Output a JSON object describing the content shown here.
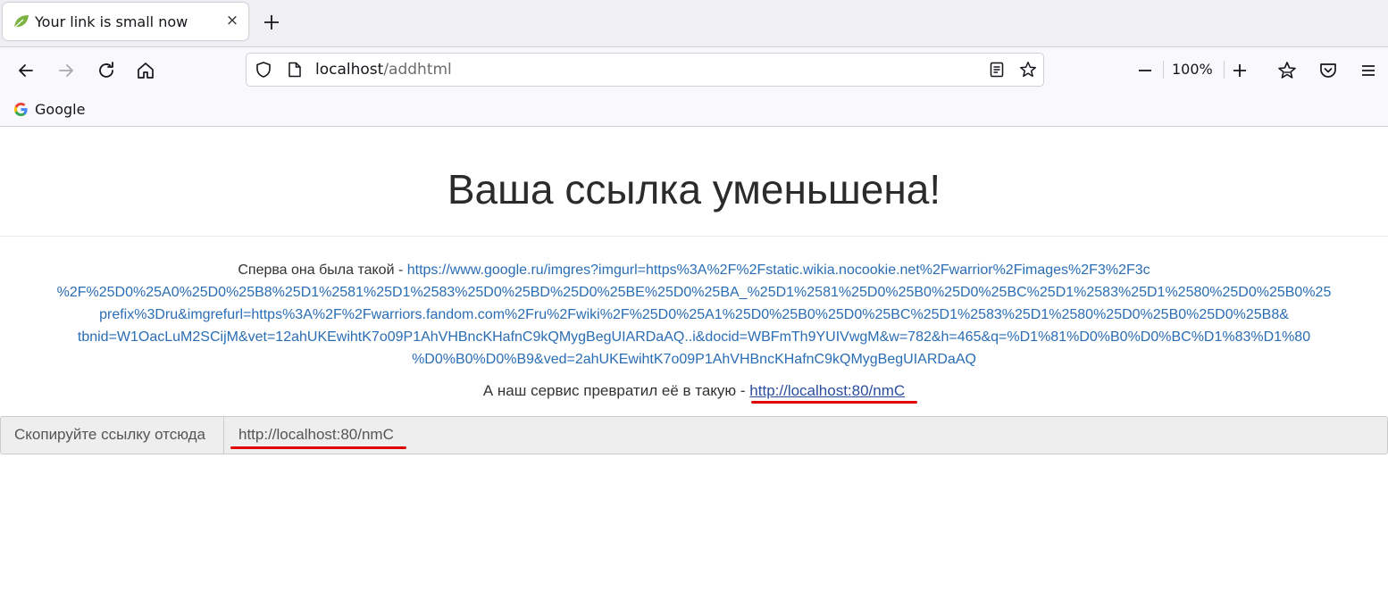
{
  "tab": {
    "title": "Your link is small now",
    "close": "×",
    "new_tab": "+"
  },
  "address_bar": {
    "host": "localhost",
    "path": "/addhtml"
  },
  "toolbar": {
    "zoom": "100%"
  },
  "bookmarks": [
    {
      "label": "Google"
    }
  ],
  "page": {
    "heading": "Ваша ссылка уменьшена!",
    "original_prefix": "Сперва она была такой - ",
    "original_url_lines": [
      "https://www.google.ru/imgres?imgurl=https%3A%2F%2Fstatic.wikia.nocookie.net%2Fwarrior%2Fimages%2F3%2F3c",
      "%2F%25D0%25A0%25D0%25B8%25D1%2581%25D1%2583%25D0%25BD%25D0%25BE%25D0%25BA_%25D1%2581%25D0%25B0%25D0%25BC%25D1%2583%25D1%2580%25D0%25B0%25",
      "prefix%3Dru&imgrefurl=https%3A%2F%2Fwarriors.fandom.com%2Fru%2Fwiki%2F%25D0%25A1%25D0%25B0%25D0%25BC%25D1%2583%25D1%2580%25D0%25B0%25D0%25B8&",
      "tbnid=W1OacLuM2SCijM&vet=12ahUKEwihtK7o09P1AhVHBncKHafnC9kQMygBegUIARDaAQ..i&docid=WBFmTh9YUIVwgM&w=782&h=465&q=%D1%81%D0%B0%D0%BC%D1%83%D1%80",
      "%D0%B0%D0%B9&ved=2ahUKEwihtK7o09P1AhVHBncKHafnC9kQMygBegUIARDaAQ"
    ],
    "short_prefix": "А наш сервис превратил её в такую - ",
    "short_url": "http://localhost:80/nmC",
    "copy_label": "Скопируйте ссылку отсюда",
    "copy_value": "http://localhost:80/nmC"
  },
  "colors": {
    "link": "#2a6db5",
    "annotation": "#e10000"
  }
}
